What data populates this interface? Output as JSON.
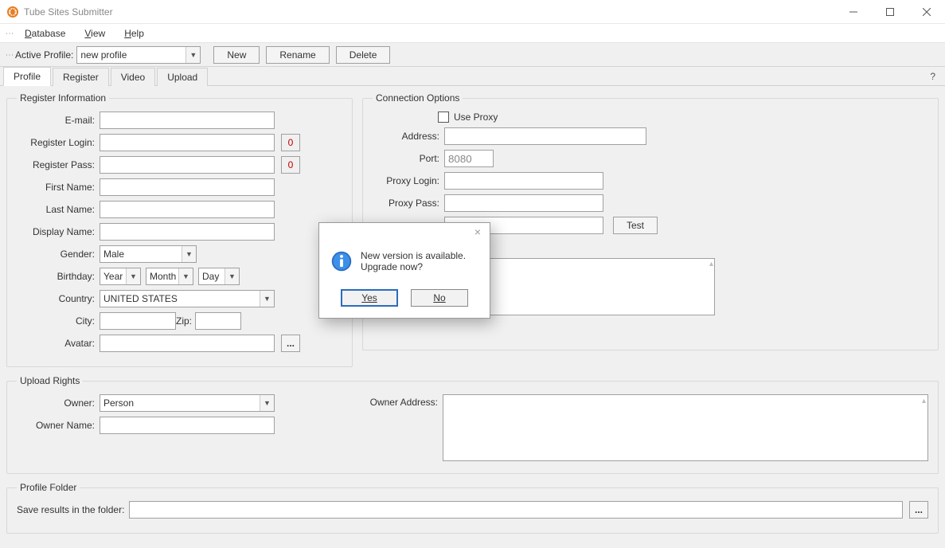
{
  "window": {
    "title": "Tube Sites Submitter"
  },
  "menubar": {
    "database": "Database",
    "database_u": "D",
    "view": "View",
    "view_u": "V",
    "help": "Help",
    "help_u": "H"
  },
  "toolbar": {
    "active_profile_label": "Active Profile:",
    "profile_value": "new profile",
    "new_btn": "New",
    "rename_btn": "Rename",
    "delete_btn": "Delete"
  },
  "tabs": {
    "profile": "Profile",
    "register": "Register",
    "video": "Video",
    "upload": "Upload"
  },
  "register_info": {
    "legend": "Register Information",
    "email_lbl": "E-mail:",
    "login_lbl": "Register Login:",
    "pass_lbl": "Register Pass:",
    "first_lbl": "First Name:",
    "last_lbl": "Last Name:",
    "display_lbl": "Display Name:",
    "gender_lbl": "Gender:",
    "gender_value": "Male",
    "birthday_lbl": "Birthday:",
    "year_value": "Year",
    "month_value": "Month",
    "day_value": "Day",
    "country_lbl": "Country:",
    "country_value": "UNITED STATES",
    "city_lbl": "City:",
    "zip_lbl": "Zip:",
    "avatar_lbl": "Avatar:",
    "count_zero": "0",
    "browse": "..."
  },
  "conn": {
    "legend": "Connection Options",
    "use_proxy": "Use Proxy",
    "address_lbl": "Address:",
    "port_lbl": "Port:",
    "port_value": "8080",
    "proxy_login_lbl": "Proxy Login:",
    "proxy_pass_lbl": "Proxy Pass:",
    "test_btn": "Test"
  },
  "upload_rights": {
    "legend": "Upload Rights",
    "owner_lbl": "Owner:",
    "owner_value": "Person",
    "owner_name_lbl": "Owner Name:",
    "owner_address_lbl": "Owner Address:"
  },
  "profile_folder": {
    "legend": "Profile Folder",
    "save_lbl": "Save results in the folder:",
    "browse": "..."
  },
  "modal": {
    "line1": "New version is available.",
    "line2": "Upgrade now?",
    "yes": "Yes",
    "no": "No"
  }
}
